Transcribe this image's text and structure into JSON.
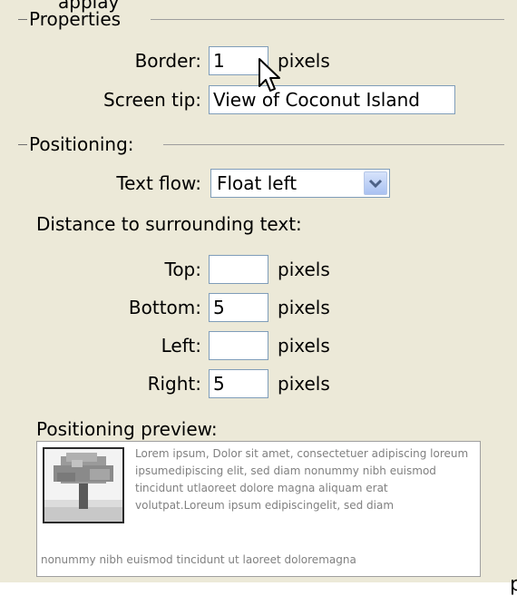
{
  "top_partial_text": "applay",
  "properties": {
    "title": "Properties",
    "border_label": "Border:",
    "border_value": "1",
    "border_unit": "pixels",
    "screentip_label": "Screen tip:",
    "screentip_value": "View of Coconut Island"
  },
  "positioning": {
    "title": "Positioning:",
    "textflow_label": "Text flow:",
    "textflow_value": "Float left",
    "distance_label": "Distance to surrounding text:",
    "rows": [
      {
        "label": "Top:",
        "value": "",
        "unit": "pixels"
      },
      {
        "label": "Bottom:",
        "value": "5",
        "unit": "pixels"
      },
      {
        "label": "Left:",
        "value": "",
        "unit": "pixels"
      },
      {
        "label": "Right:",
        "value": "5",
        "unit": "pixels"
      }
    ]
  },
  "preview": {
    "title": "Positioning preview:",
    "text": "Lorem ipsum, Dolor sit amet, consectetuer adipiscing loreum ipsumedipiscing elit, sed diam nonummy nibh euismod tincidunt utlaoreet dolore magna aliquam erat volutpat.Loreum ipsum edipiscingelit, sed diam",
    "text_bottom": "nonummy nibh euismod tincidunt ut laoreet doloremagna"
  },
  "outside_letter": "p",
  "colors": {
    "dialog_bg": "#ece9d8",
    "input_border": "#7f9db9",
    "preview_text": "#808080"
  }
}
